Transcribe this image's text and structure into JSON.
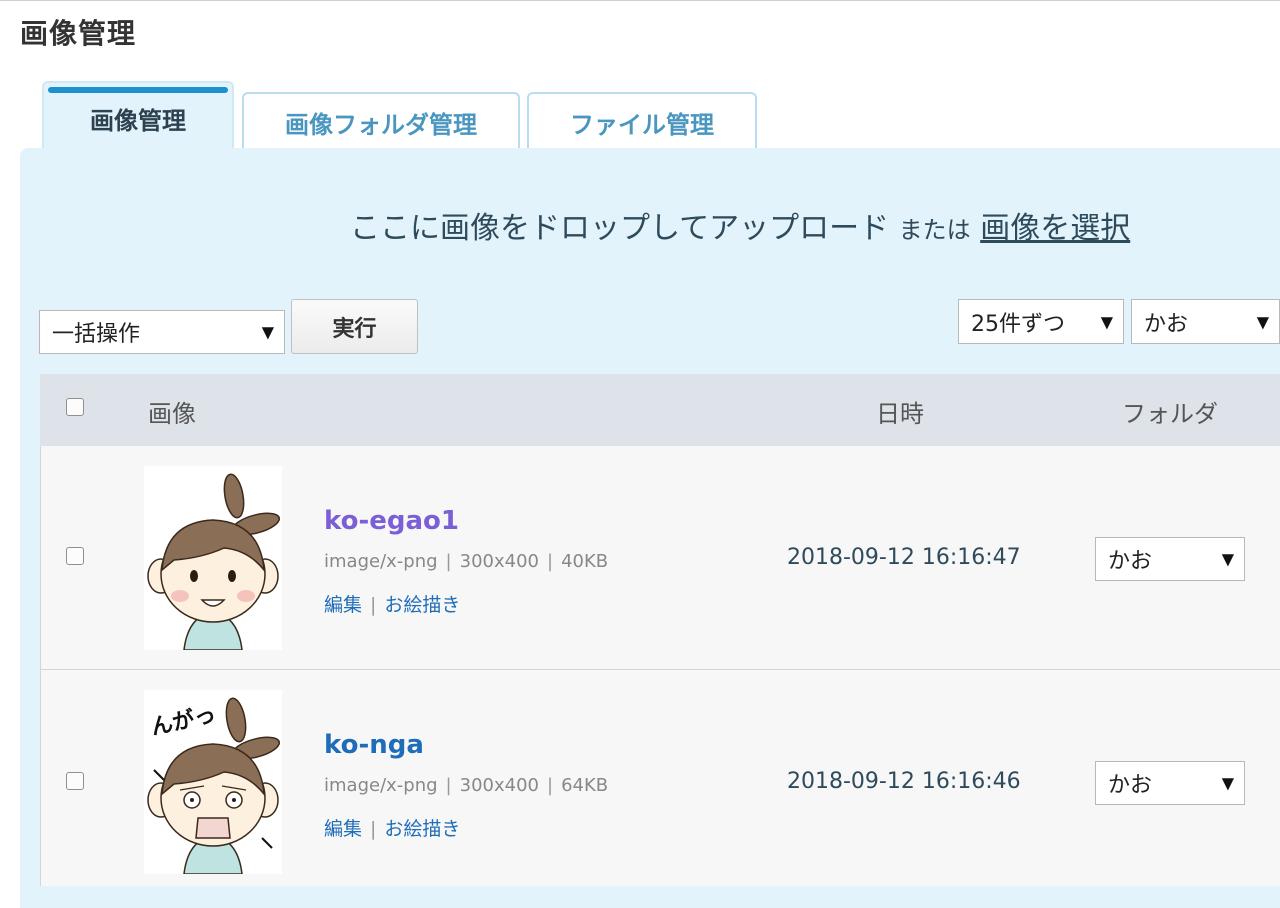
{
  "page": {
    "title": "画像管理"
  },
  "tabs": [
    {
      "label": "画像管理",
      "active": true
    },
    {
      "label": "画像フォルダ管理",
      "active": false
    },
    {
      "label": "ファイル管理",
      "active": false
    }
  ],
  "upload": {
    "drop_text": "ここに画像をドロップしてアップロード",
    "or_text": "または",
    "select_link": "画像を選択"
  },
  "toolbar": {
    "bulk_select": "一括操作",
    "execute_label": "実行",
    "per_page": "25件ずつ",
    "folder_filter": "かお"
  },
  "table": {
    "headers": {
      "image": "画像",
      "date": "日時",
      "folder": "フォルダ"
    },
    "rows": [
      {
        "name": "ko-egao1",
        "name_color": "#7b5fd6",
        "mime": "image/x-png",
        "dimensions": "300x400",
        "size": "40KB",
        "edit": "編集",
        "draw": "お絵描き",
        "date": "2018-09-12 16:16:47",
        "folder": "かお",
        "thumb_icon": "smiling-child-illustration"
      },
      {
        "name": "ko-nga",
        "name_color": "#1f6db8",
        "mime": "image/x-png",
        "dimensions": "300x400",
        "size": "64KB",
        "edit": "編集",
        "draw": "お絵描き",
        "date": "2018-09-12 16:16:46",
        "folder": "かお",
        "thumb_icon": "angry-child-illustration",
        "thumb_text": "んがっ"
      }
    ]
  },
  "separator": "|",
  "arrow_glyph": "▼"
}
